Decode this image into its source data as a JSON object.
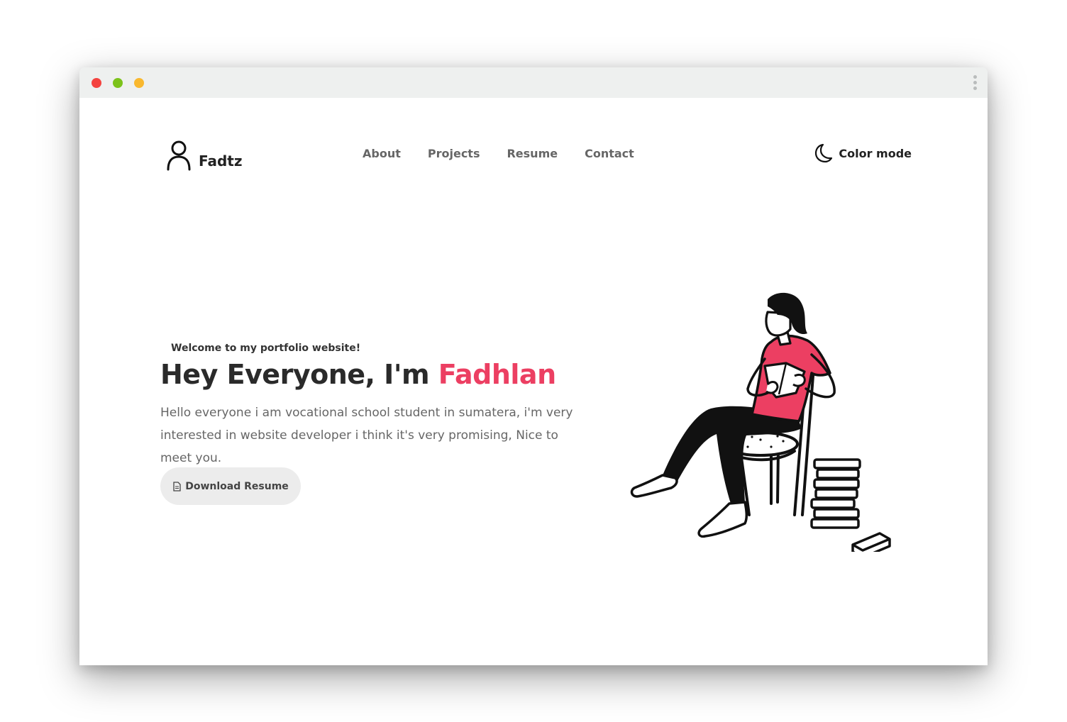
{
  "window": {
    "controls": [
      "close",
      "maximize",
      "minimize"
    ]
  },
  "nav": {
    "brand": "Fadtz",
    "items": [
      {
        "label": "About"
      },
      {
        "label": "Projects"
      },
      {
        "label": "Resume"
      },
      {
        "label": "Contact"
      }
    ],
    "color_mode_label": "Color mode"
  },
  "hero": {
    "welcome": "Welcome to my portfolio website!",
    "headline_prefix": "Hey Everyone, I'm ",
    "headline_name": "Fadhlan",
    "intro": "Hello everyone i am vocational school student in sumatera, i'm very interested in website developer i think it's very promising, Nice to meet you.",
    "download_label": "Download Resume"
  },
  "colors": {
    "accent": "#ec3f62",
    "close": "#f4433f",
    "maximize": "#7cc21a",
    "minimize": "#f9b82e",
    "button_bg": "#ececec",
    "titlebar_bg": "#eef0ef"
  },
  "icons": {
    "brand": "user-icon",
    "color_mode": "moon-icon",
    "download": "document-icon",
    "menu": "kebab-menu-icon"
  }
}
